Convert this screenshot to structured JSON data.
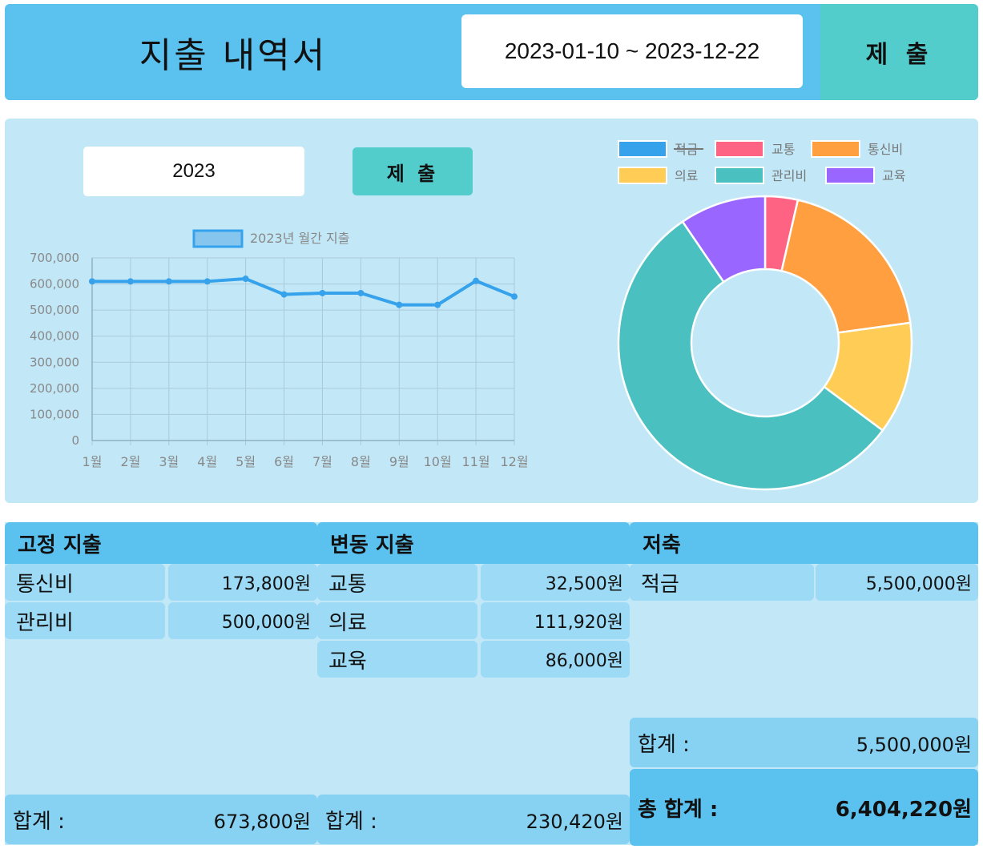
{
  "header": {
    "title": "지출 내역서",
    "date_range": "2023-01-10 ~ 2023-12-22",
    "submit_label": "제 출"
  },
  "controls": {
    "year_value": "2023",
    "submit_label": "제 출"
  },
  "colors": {
    "header_bg": "#5bc2ef",
    "panel_bg": "#c2e8f8",
    "button_bg": "#53cccc",
    "line": "#36a2eb"
  },
  "chart_data": [
    {
      "type": "line",
      "legend": [
        "2023년 월간 지출"
      ],
      "categories": [
        "1월",
        "2월",
        "3월",
        "4월",
        "5월",
        "6월",
        "7월",
        "8월",
        "9월",
        "10월",
        "11월",
        "12월"
      ],
      "series": [
        {
          "name": "2023년 월간 지출",
          "values": [
            610000,
            610000,
            610000,
            610000,
            620000,
            560000,
            565000,
            565000,
            520000,
            520000,
            612000,
            552000
          ]
        }
      ],
      "y_ticks": [
        "0",
        "100,000",
        "200,000",
        "300,000",
        "400,000",
        "500,000",
        "600,000",
        "700,000"
      ],
      "ylim": [
        0,
        700000
      ],
      "grid": true,
      "legend_position": "top"
    },
    {
      "type": "pie",
      "variant": "doughnut",
      "legend_position": "top",
      "labels": [
        "적금",
        "교통",
        "통신비",
        "의료",
        "관리비",
        "교육"
      ],
      "hidden": [
        "적금"
      ],
      "values": [
        5500000,
        32500,
        173800,
        111920,
        500000,
        86000
      ],
      "colors": [
        "#36a2eb",
        "#ff6384",
        "#ff9f40",
        "#ffcd56",
        "#4bc0c0",
        "#9966ff"
      ]
    }
  ],
  "fixed": {
    "title": "고정 지출",
    "items": [
      {
        "label": "통신비",
        "value": "173,800원"
      },
      {
        "label": "관리비",
        "value": "500,000원"
      }
    ],
    "sum_label": "합계 :",
    "sum_value": "673,800원"
  },
  "variable": {
    "title": "변동 지출",
    "items": [
      {
        "label": "교통",
        "value": "32,500원"
      },
      {
        "label": "의료",
        "value": "111,920원"
      },
      {
        "label": "교육",
        "value": "86,000원"
      }
    ],
    "sum_label": "합계 :",
    "sum_value": "230,420원"
  },
  "savings": {
    "title": "저축",
    "items": [
      {
        "label": "적금",
        "value": "5,500,000원"
      }
    ],
    "sum_label": "합계 :",
    "sum_value": "5,500,000원",
    "total_label": "총 합계 :",
    "total_value": "6,404,220원"
  }
}
